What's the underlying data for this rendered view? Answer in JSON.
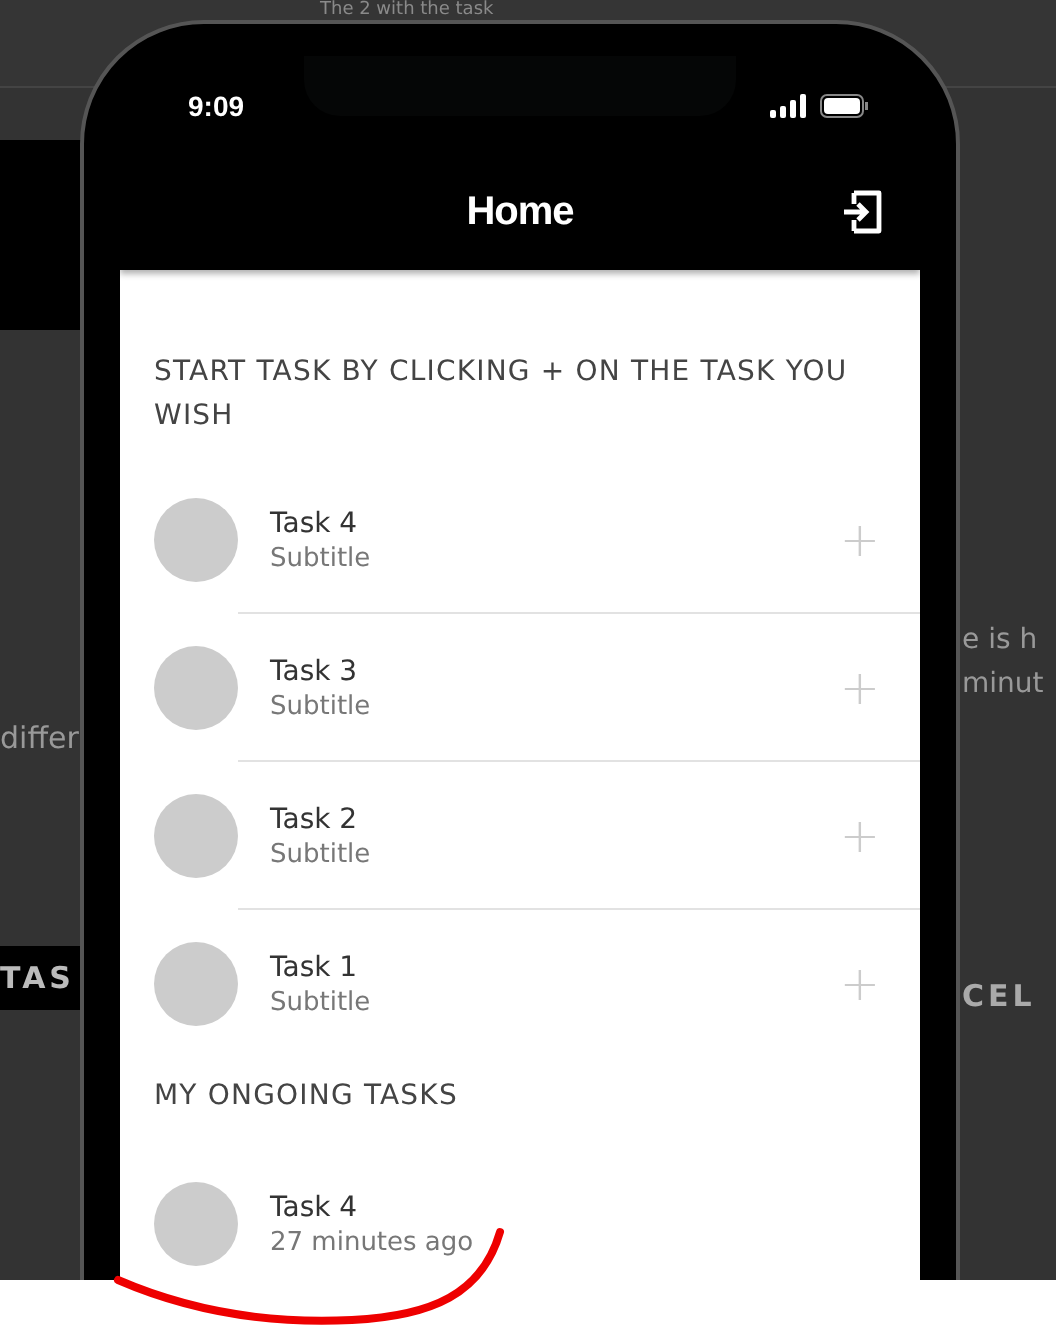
{
  "background_page": {
    "header_text": "The 2 with the task",
    "fragments": [
      {
        "kind": "text",
        "text": "differ"
      },
      {
        "kind": "button",
        "text": "TAS"
      },
      {
        "kind": "text",
        "text": "e is h"
      },
      {
        "kind": "text",
        "text": "minut"
      },
      {
        "kind": "button",
        "text": "CEL"
      }
    ]
  },
  "phone": {
    "status_bar": {
      "time": "9:09"
    },
    "app_bar": {
      "title": "Home"
    },
    "sections": [
      {
        "heading": "START TASK BY CLICKING + ON THE TASK YOU WISH",
        "items": [
          {
            "kind": "startable",
            "title": "Task 4",
            "subtitle": "Subtitle",
            "action": "+"
          },
          {
            "kind": "startable",
            "title": "Task 3",
            "subtitle": "Subtitle",
            "action": "+"
          },
          {
            "kind": "startable",
            "title": "Task 2",
            "subtitle": "Subtitle",
            "action": "+"
          },
          {
            "kind": "startable",
            "title": "Task 1",
            "subtitle": "Subtitle",
            "action": "+"
          }
        ]
      },
      {
        "heading": "MY ONGOING TASKS",
        "items": [
          {
            "kind": "ongoing",
            "title": "Task 4",
            "subtitle": "27 minutes ago"
          }
        ]
      }
    ]
  }
}
